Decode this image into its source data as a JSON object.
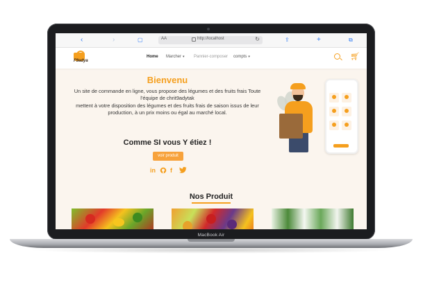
{
  "device": {
    "label": "MacBook Air"
  },
  "browser": {
    "text_size_label": "AA",
    "url": "http://localhost"
  },
  "navbar": {
    "logo_text": "F9adya",
    "items": [
      {
        "label": "Home"
      },
      {
        "label": "Marcher"
      },
      {
        "label": "Pannier-composer"
      },
      {
        "label": "compts"
      }
    ]
  },
  "hero": {
    "title": "Bienvenu",
    "line1": "Un site de commande en ligne, vous propose des légumes et des fruits frais Toute",
    "line2": "l'équipe de chrit9adytak",
    "line3": "mettent à votre disposition des légumes et des fruits frais de saison issus de leur",
    "line4": "production, à un prix moins ou égal au marché local.",
    "slogan": "Comme SI vous Y étiez !",
    "cta": "voir produit"
  },
  "social": {
    "linkedin": "in",
    "facebook": "f"
  },
  "products": {
    "title": "Nos Produit"
  },
  "colors": {
    "accent": "#f59f1e",
    "page_bg": "#fbf5ee"
  }
}
